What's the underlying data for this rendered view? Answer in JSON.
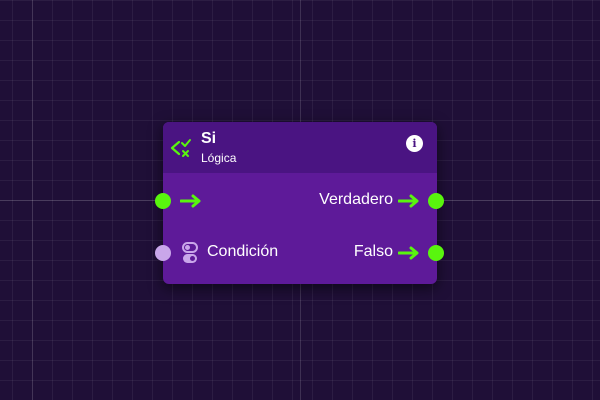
{
  "node": {
    "title": "Si",
    "subtitle": "Lógica",
    "icon": "branch-check-cross-icon",
    "info_icon": "info-icon",
    "info_label": "i"
  },
  "pins": {
    "exec_in": {
      "icon": "exec-arrow-icon"
    },
    "condition": {
      "label": "Condición",
      "icon": "toggle-icon"
    },
    "true_out": {
      "label": "Verdadero",
      "icon": "exec-arrow-icon"
    },
    "false_out": {
      "label": "Falso",
      "icon": "exec-arrow-icon"
    }
  },
  "colors": {
    "canvas": "#1f0f37",
    "node_body": "#5e1a99",
    "node_header": "#4a1482",
    "exec_port": "#59f50e",
    "bool_port": "#c9a6ea"
  }
}
